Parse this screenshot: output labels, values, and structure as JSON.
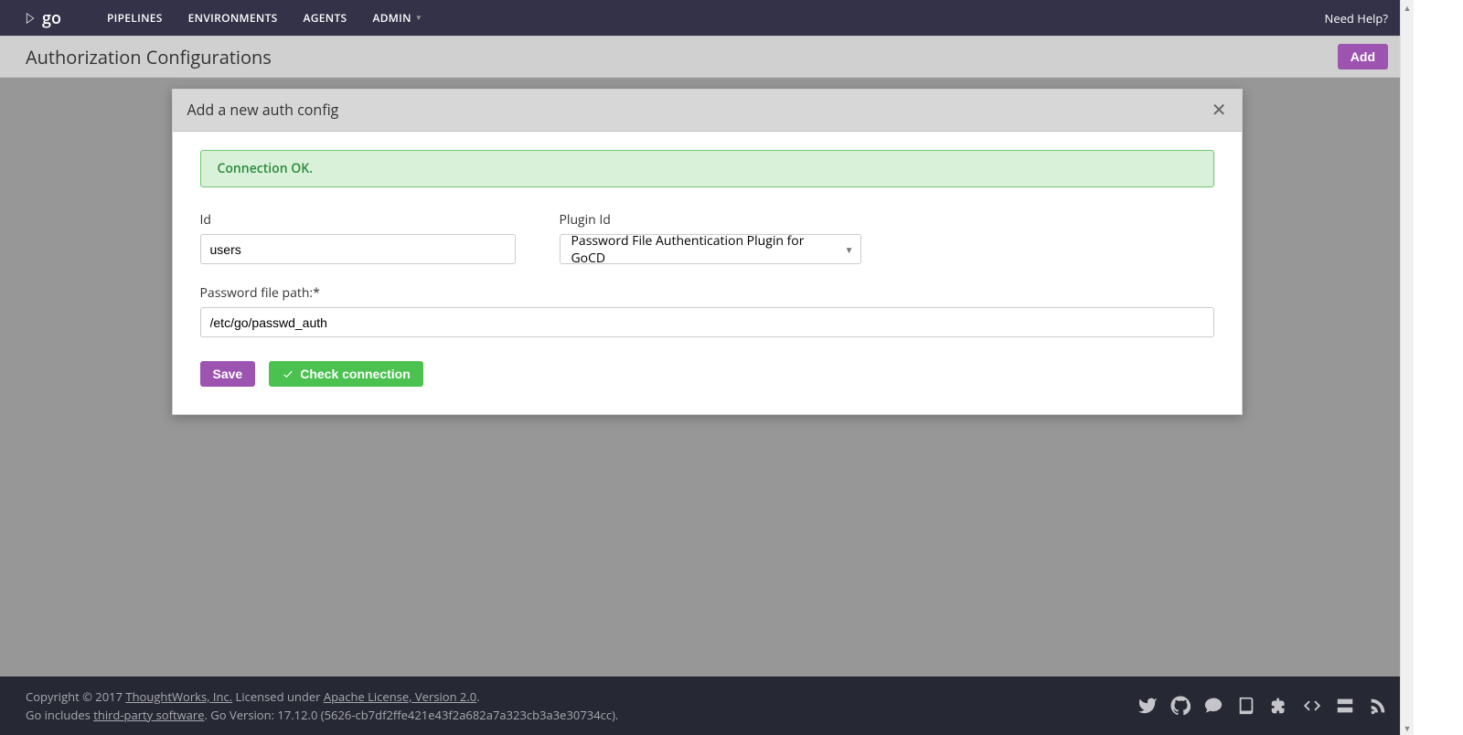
{
  "nav": {
    "items": [
      "PIPELINES",
      "ENVIRONMENTS",
      "AGENTS",
      "ADMIN"
    ],
    "help": "Need Help?"
  },
  "page": {
    "title": "Authorization Configurations",
    "add_label": "Add"
  },
  "modal": {
    "title": "Add a new auth config",
    "alert": "Connection OK.",
    "fields": {
      "id_label": "Id",
      "id_value": "users",
      "plugin_label": "Plugin Id",
      "plugin_value": "Password File Authentication Plugin for GoCD",
      "pw_label": "Password file path:*",
      "pw_value": "/etc/go/passwd_auth"
    },
    "buttons": {
      "save": "Save",
      "check": "Check connection"
    }
  },
  "footer": {
    "line1_a": "Copyright © 2017 ",
    "tw_link": "ThoughtWorks, Inc.",
    "line1_b": " Licensed under ",
    "apache_link": "Apache License, Version 2.0",
    "line1_c": ".",
    "line2_a": "Go includes ",
    "tps_link": "third-party software",
    "line2_b": ". Go Version: 17.12.0 (5626-cb7df2ffe421e43f2a682a7a323cb3a3e30734cc)."
  }
}
